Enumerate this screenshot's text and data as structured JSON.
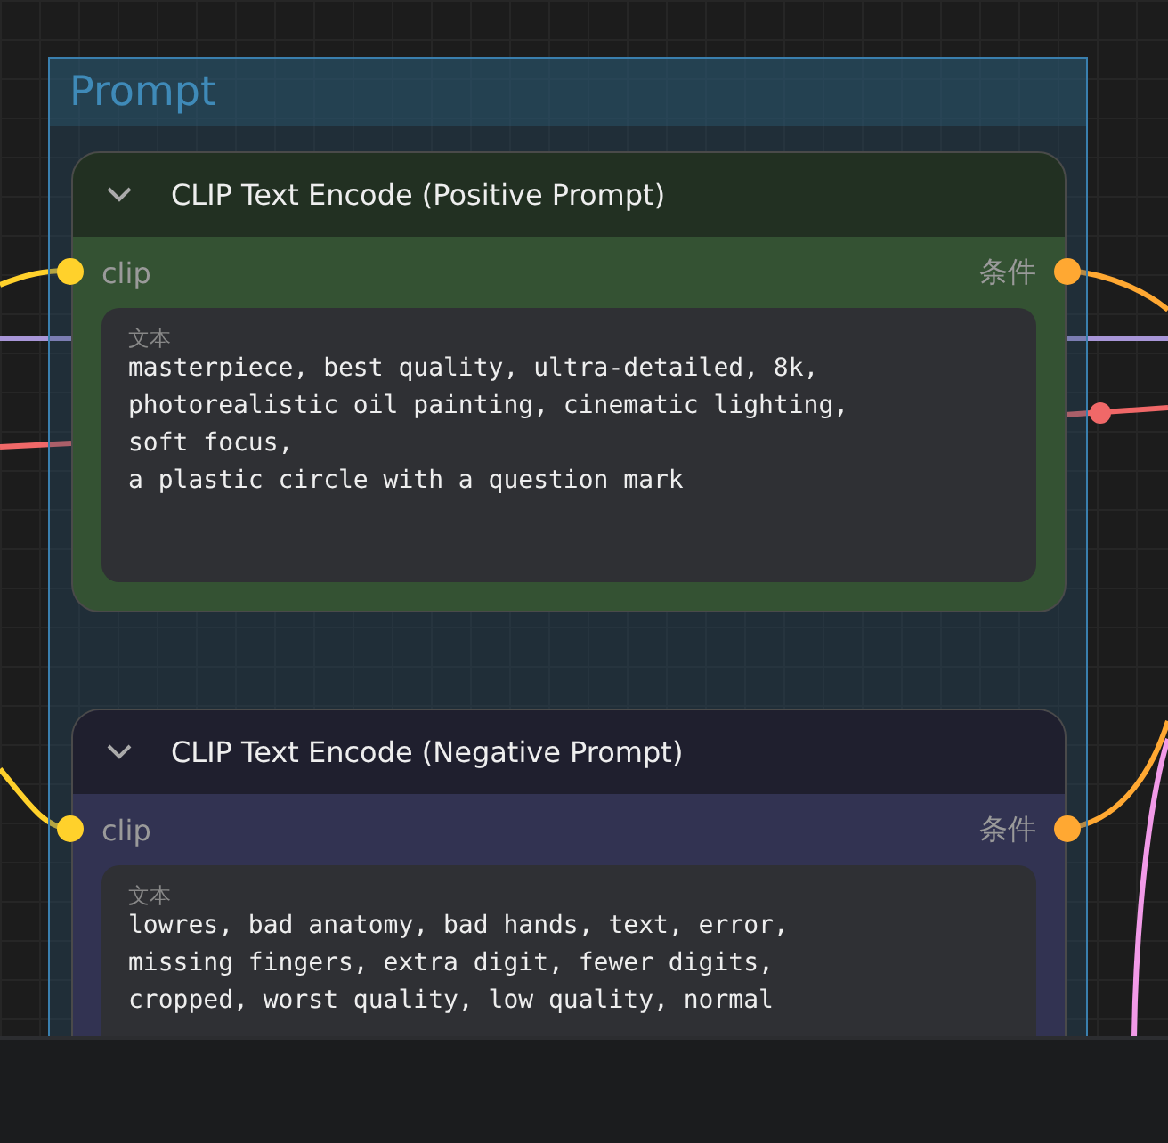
{
  "group": {
    "title": "Prompt"
  },
  "nodes": [
    {
      "title": "CLIP Text Encode (Positive Prompt)",
      "kind": "positive",
      "expanded": true,
      "input": {
        "label": "clip",
        "color": "#ffd12b"
      },
      "output": {
        "label": "条件",
        "color": "#ffa832"
      },
      "widget": {
        "label": "文本",
        "value": "masterpiece, best quality, ultra-detailed, 8k,\nphotorealistic oil painting, cinematic lighting,\nsoft focus,\na plastic circle with a question mark"
      }
    },
    {
      "title": "CLIP Text Encode (Negative Prompt)",
      "kind": "negative",
      "expanded": true,
      "input": {
        "label": "clip",
        "color": "#ffd12b"
      },
      "output": {
        "label": "条件",
        "color": "#ffa832"
      },
      "widget": {
        "label": "文本",
        "value": "lowres, bad anatomy, bad hands, text, error,\nmissing fingers, extra digit, fewer digits,\ncropped, worst quality, low quality, normal"
      }
    }
  ]
}
